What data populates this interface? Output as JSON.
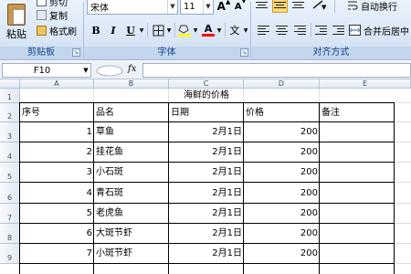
{
  "clipboard": {
    "cut_label": "剪切",
    "copy_label": "复制",
    "format_painter_label": "格式刷",
    "paste_label": "粘贴",
    "group_label": "剪贴板"
  },
  "font": {
    "family_value": "宋体",
    "size_value": "11",
    "bold": "B",
    "italic": "I",
    "underline": "U",
    "grow": "A",
    "shrink": "A",
    "font_color_letter": "A",
    "phonetic_label": "文",
    "group_label": "字体",
    "fill_color": "#ffff00",
    "font_color": "#ff0000"
  },
  "alignment": {
    "wrap_label": "自动换行",
    "merge_label": "合并后居中",
    "group_label": "对齐方式"
  },
  "formula_bar": {
    "name_box": "F10",
    "fx": "fx",
    "formula": ""
  },
  "sheet": {
    "columns": [
      "A",
      "B",
      "C",
      "D",
      "E"
    ],
    "rows": [
      "1",
      "2",
      "3",
      "4",
      "5",
      "6",
      "7",
      "8",
      "9"
    ],
    "title": "海鲜的价格",
    "headers": [
      "序号",
      "品名",
      "日期",
      "价格",
      "备注"
    ],
    "data": [
      {
        "no": "1",
        "name": "草鱼",
        "date": "2月1日",
        "price": "200",
        "note": ""
      },
      {
        "no": "2",
        "name": "挂花鱼",
        "date": "2月1日",
        "price": "200",
        "note": ""
      },
      {
        "no": "3",
        "name": "小石斑",
        "date": "2月1日",
        "price": "200",
        "note": ""
      },
      {
        "no": "4",
        "name": "青石斑",
        "date": "2月1日",
        "price": "200",
        "note": ""
      },
      {
        "no": "5",
        "name": "老虎鱼",
        "date": "2月1日",
        "price": "200",
        "note": ""
      },
      {
        "no": "6",
        "name": "大斑节虾",
        "date": "2月1日",
        "price": "200",
        "note": ""
      },
      {
        "no": "7",
        "name": "小斑节虾",
        "date": "2月1日",
        "price": "200",
        "note": ""
      }
    ]
  }
}
